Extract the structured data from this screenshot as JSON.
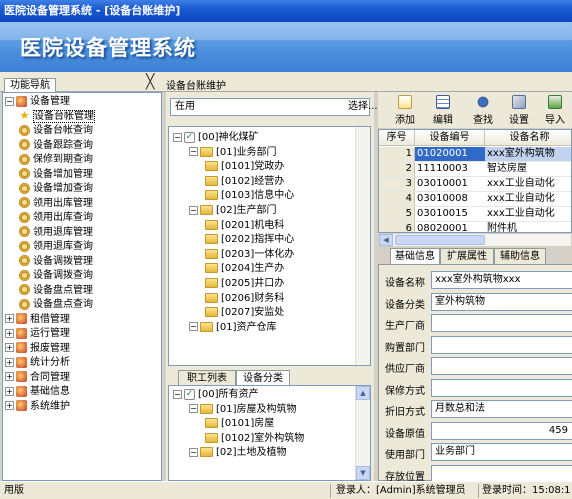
{
  "window": {
    "title": "医院设备管理系统 - [设备台账维护]"
  },
  "banner": {
    "title": "医院设备管理系统"
  },
  "nav": {
    "tab_label": "功能导航",
    "items": [
      {
        "label": "设备管理",
        "level": 0,
        "expanded": true,
        "icon": "module-icon"
      },
      {
        "label": "设备台帐管理",
        "level": 1,
        "selected": true,
        "icon": "star-icon"
      },
      {
        "label": "设备台帐查询",
        "level": 1,
        "icon": "gear-icon"
      },
      {
        "label": "设备跟踪查询",
        "level": 1,
        "icon": "gear-icon"
      },
      {
        "label": "保修到期查询",
        "level": 1,
        "icon": "gear-icon"
      },
      {
        "label": "设备增加管理",
        "level": 1,
        "icon": "gear-icon"
      },
      {
        "label": "设备增加查询",
        "level": 1,
        "icon": "gear-icon"
      },
      {
        "label": "领用出库管理",
        "level": 1,
        "icon": "gear-icon"
      },
      {
        "label": "领用出库查询",
        "level": 1,
        "icon": "gear-icon"
      },
      {
        "label": "领用退库管理",
        "level": 1,
        "icon": "gear-icon"
      },
      {
        "label": "领用退库查询",
        "level": 1,
        "icon": "gear-icon"
      },
      {
        "label": "设备调拨管理",
        "level": 1,
        "icon": "gear-icon"
      },
      {
        "label": "设备调拨查询",
        "level": 1,
        "icon": "gear-icon"
      },
      {
        "label": "设备盘点管理",
        "level": 1,
        "icon": "gear-icon"
      },
      {
        "label": "设备盘点查询",
        "level": 1,
        "icon": "gear-icon"
      },
      {
        "label": "租借管理",
        "level": 0,
        "icon": "module-icon"
      },
      {
        "label": "运行管理",
        "level": 0,
        "icon": "module-icon"
      },
      {
        "label": "报废管理",
        "level": 0,
        "icon": "module-icon"
      },
      {
        "label": "统计分析",
        "level": 0,
        "icon": "module-icon"
      },
      {
        "label": "合同管理",
        "level": 0,
        "icon": "module-icon"
      },
      {
        "label": "基础信息",
        "level": 0,
        "icon": "module-icon"
      },
      {
        "label": "系统维护",
        "level": 0,
        "icon": "module-icon"
      }
    ]
  },
  "panel": {
    "title": "设备台账维护",
    "close_glyph": "╳"
  },
  "filter": {
    "status_value": "在用",
    "select_label": "选择..."
  },
  "org_tree": [
    {
      "label": "[00]神化煤矿",
      "level": 0,
      "check": true
    },
    {
      "label": "[01]业务部门",
      "level": 1
    },
    {
      "label": "[0101]党政办",
      "level": 2
    },
    {
      "label": "[0102]经营办",
      "level": 2
    },
    {
      "label": "[0103]信息中心",
      "level": 2
    },
    {
      "label": "[02]生产部门",
      "level": 1
    },
    {
      "label": "[0201]机电科",
      "level": 2
    },
    {
      "label": "[0202]指挥中心",
      "level": 2
    },
    {
      "label": "[0203]一体化办",
      "level": 2
    },
    {
      "label": "[0204]生产办",
      "level": 2
    },
    {
      "label": "[0205]井口办",
      "level": 2
    },
    {
      "label": "[0206]财务科",
      "level": 2
    },
    {
      "label": "[0207]安监处",
      "level": 2
    },
    {
      "label": "[01]资产仓库",
      "level": 1
    }
  ],
  "mid_tabs": [
    "职工列表",
    "设备分类"
  ],
  "cat_tree": [
    {
      "label": "[00]所有资产",
      "level": 0,
      "check": true
    },
    {
      "label": "[01]房屋及构筑物",
      "level": 1
    },
    {
      "label": "[0101]房屋",
      "level": 2
    },
    {
      "label": "[0102]室外构筑物",
      "level": 2
    },
    {
      "label": "[02]土地及植物",
      "level": 1
    }
  ],
  "toolbar": {
    "add": "添加",
    "edit": "编辑",
    "search": "查找",
    "settings": "设置",
    "import": "导入"
  },
  "grid": {
    "headers": [
      "序号",
      "设备编号",
      "设备名称"
    ],
    "rows": [
      {
        "no": "1",
        "code": "01020001",
        "name": "xxx室外构筑物"
      },
      {
        "no": "2",
        "code": "11110003",
        "name": "智达房屋"
      },
      {
        "no": "3",
        "code": "03010001",
        "name": "xxx工业自动化"
      },
      {
        "no": "4",
        "code": "03010008",
        "name": "xxx工业自动化"
      },
      {
        "no": "5",
        "code": "03010015",
        "name": "xxx工业自动化"
      },
      {
        "no": "6",
        "code": "08020001",
        "name": "附件机"
      }
    ]
  },
  "detail_tabs": [
    "基础信息",
    "扩展属性",
    "辅助信息"
  ],
  "detail": {
    "fields": [
      {
        "label": "设备名称",
        "value": "xxx室外构筑物xxx"
      },
      {
        "label": "设备分类",
        "value": "室外构筑物"
      },
      {
        "label": "生产厂商",
        "value": ""
      },
      {
        "label": "购置部门",
        "value": ""
      },
      {
        "label": "供应厂商",
        "value": ""
      },
      {
        "label": "保修方式",
        "value": ""
      },
      {
        "label": "折旧方式",
        "value": "月数总和法"
      },
      {
        "label": "设备原值",
        "value": "459"
      },
      {
        "label": "使用部门",
        "value": "业务部门"
      },
      {
        "label": "存放位置",
        "value": ""
      }
    ]
  },
  "statusbar": {
    "left": "用版",
    "user": "登录人：[Admin]系统管理员",
    "time": "登录时间：15:08:1"
  }
}
